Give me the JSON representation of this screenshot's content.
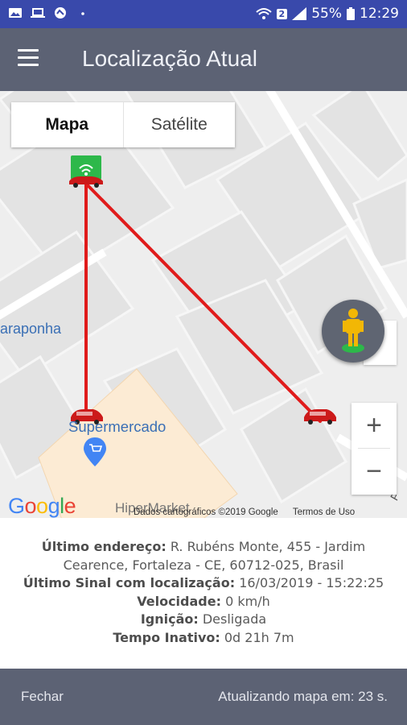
{
  "status_bar": {
    "battery_percent": "55%",
    "time": "12:29",
    "sim_badge": "2",
    "icons": [
      "gallery-icon",
      "laptop-icon",
      "security-icon",
      "dot-icon",
      "wifi-icon",
      "signal-icon",
      "battery-icon"
    ]
  },
  "app_bar": {
    "title": "Localização Atual",
    "menu_icon": "hamburger-menu-icon"
  },
  "map": {
    "toggle": {
      "map_label": "Mapa",
      "satellite_label": "Satélite",
      "selected": "Mapa"
    },
    "labels": {
      "street_left": "araponha",
      "supermarket": "Supermercado",
      "hipermarket": "HiperMarket",
      "street_right": "inão P"
    },
    "google_logo": "Google",
    "attribution": "Dados cartográficos ©2019 Google",
    "terms": "Termos de Uso",
    "zoom_in": "+",
    "zoom_out": "−",
    "route_color": "#e01b1b",
    "marker_color": "#2db84a",
    "pegman_color": "#f2b705"
  },
  "info": {
    "last_address_label": "Último endereço:",
    "last_address_value_1": "R. Rubéns Monte, 455 - Jardim",
    "last_address_value_2": "Cearence, Fortaleza - CE, 60712-025, Brasil",
    "last_signal_label": "Último Sinal com localização:",
    "last_signal_value": "16/03/2019 - 15:22:25",
    "speed_label": "Velocidade:",
    "speed_value": "0 km/h",
    "ignition_label": "Ignição:",
    "ignition_value": "Desligada",
    "idle_label": "Tempo Inativo:",
    "idle_value": "0d 21h 7m"
  },
  "bottom_bar": {
    "close_label": "Fechar",
    "refresh_text": "Atualizando mapa em: 23 s."
  }
}
